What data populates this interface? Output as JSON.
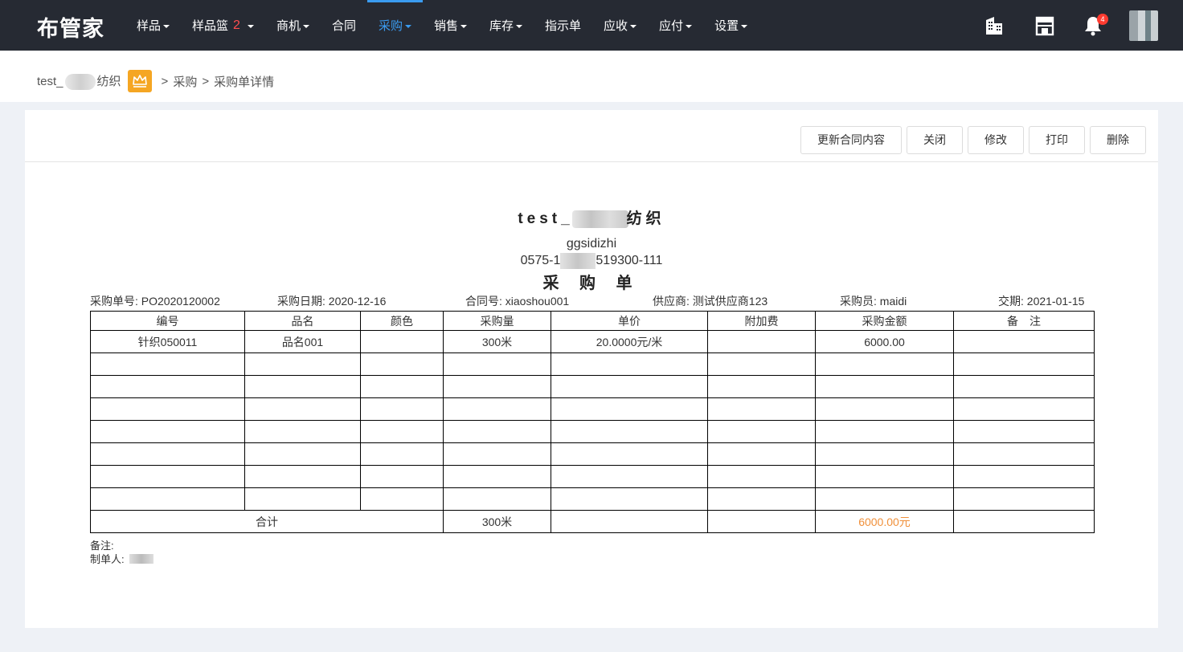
{
  "app": {
    "logo": "布管家"
  },
  "nav": {
    "items": [
      {
        "label": "样品",
        "dropdown": true
      },
      {
        "label": "样品篮",
        "count": "2",
        "dropdown": true
      },
      {
        "label": "商机",
        "dropdown": true
      },
      {
        "label": "合同",
        "dropdown": false
      },
      {
        "label": "采购",
        "dropdown": true,
        "active": true
      },
      {
        "label": "销售",
        "dropdown": true
      },
      {
        "label": "库存",
        "dropdown": true
      },
      {
        "label": "指示单",
        "dropdown": false
      },
      {
        "label": "应收",
        "dropdown": true
      },
      {
        "label": "应付",
        "dropdown": true
      },
      {
        "label": "设置",
        "dropdown": true
      }
    ],
    "icons": [
      "building-icon",
      "store-icon",
      "bell-icon"
    ],
    "notification_count": "4",
    "accent_color": "#3a9bf0"
  },
  "breadcrumb": {
    "company_prefix": "test_",
    "company_suffix": "纺织",
    "sep1": ">",
    "level1": "采购",
    "sep2": ">",
    "level2": "采购单详情"
  },
  "toolbar": {
    "update_label": "更新合同内容",
    "close_label": "关闭",
    "edit_label": "修改",
    "print_label": "打印",
    "delete_label": "删除"
  },
  "doc": {
    "company_prefix": "test_",
    "company_suffix": "纺织",
    "address": "ggsidizhi",
    "phone_prefix": "0575-1",
    "phone_suffix": "519300-111",
    "title": "采 购 单",
    "meta": {
      "order_no_label": "采购单号:",
      "order_no": "PO2020120002",
      "date_label": "采购日期:",
      "date": "2020-12-16",
      "contract_label": "合同号:",
      "contract": "xiaoshou001",
      "supplier_label": "供应商:",
      "supplier": "测试供应商123",
      "buyer_label": "采购员:",
      "buyer": "maidi",
      "delivery_label": "交期:",
      "delivery": "2021-01-15"
    },
    "table": {
      "headers": [
        "编号",
        "品名",
        "颜色",
        "采购量",
        "单价",
        "附加费",
        "采购金额",
        "备　注"
      ],
      "rows": [
        [
          "针织050011",
          "品名001",
          "",
          "300米",
          "20.0000元/米",
          "",
          "6000.00",
          ""
        ]
      ],
      "empty_rows": 7,
      "total": {
        "label": "合计",
        "quantity": "300米",
        "unit_price": "",
        "surcharge": "",
        "amount": "6000.00元",
        "remark": ""
      }
    },
    "remark_label": "备注:",
    "maker_label": "制单人:"
  }
}
